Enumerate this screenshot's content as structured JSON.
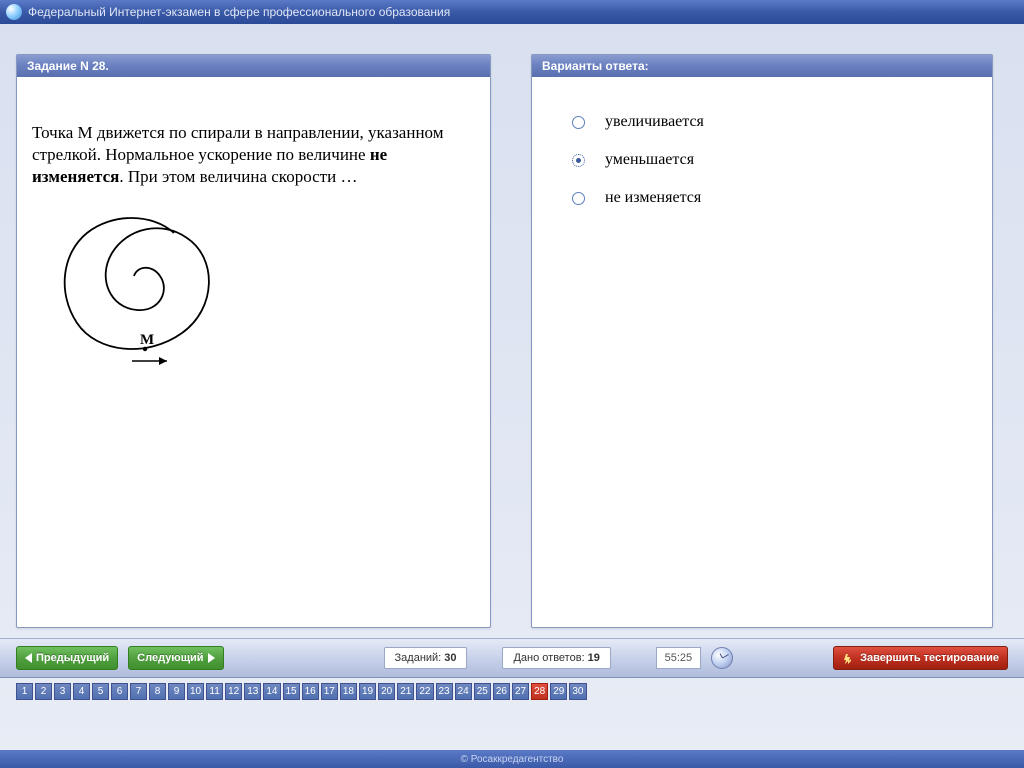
{
  "titlebar": {
    "title": "Федеральный Интернет-экзамен в сфере профессионального образования"
  },
  "question": {
    "header": "Задание N 28.",
    "text_before_bold": "Точка М движется по спирали в направлении, указанном стрелкой. Нормальное ускорение по величине ",
    "text_bold": "не изменяется",
    "text_after_bold": ". При этом величина скорости …",
    "point_label": "M"
  },
  "answers": {
    "header": "Варианты ответа:",
    "options": [
      {
        "label": "увеличивается",
        "selected": false
      },
      {
        "label": "уменьшается",
        "selected": true
      },
      {
        "label": "не изменяется",
        "selected": false
      }
    ]
  },
  "nav": {
    "prev": "Предыдущий",
    "next": "Следующий",
    "tasks_label": "Заданий:",
    "tasks_count": "30",
    "answered_label": "Дано ответов:",
    "answered_count": "19",
    "timer": "55:25",
    "finish": "Завершить тестирование"
  },
  "numbers": {
    "total": 30,
    "current": 28
  },
  "footer": "© Росаккредагентство"
}
